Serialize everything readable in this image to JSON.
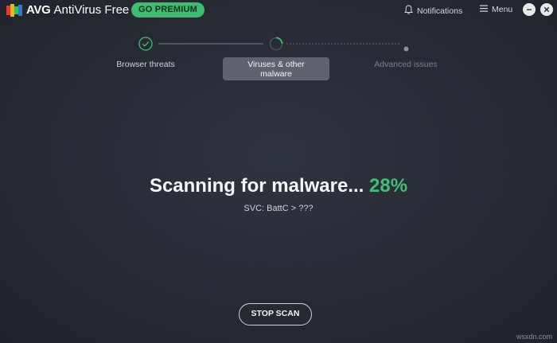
{
  "header": {
    "brand": "AVG",
    "product": "AntiVirus Free",
    "premium_label": "GO PREMIUM",
    "notifications_label": "Notifications",
    "menu_label": "Menu"
  },
  "steps": [
    {
      "label": "Browser threats",
      "state": "done"
    },
    {
      "label": "Viruses & other malware",
      "state": "active"
    },
    {
      "label": "Advanced issues",
      "state": "pending"
    }
  ],
  "scan": {
    "title": "Scanning for malware...",
    "percent": "28%",
    "current_item": "SVC: BattC > ???"
  },
  "actions": {
    "stop_label": "STOP SCAN"
  },
  "watermark": "wsxdn.com",
  "colors": {
    "accent": "#3dbd6e",
    "background": "#262a33"
  }
}
